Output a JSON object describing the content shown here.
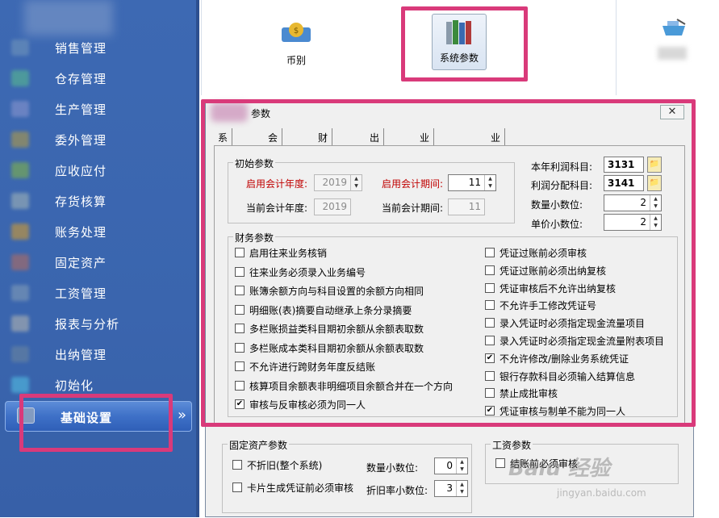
{
  "sidebar": {
    "items": [
      {
        "label": "销售管理",
        "icon": "sales-icon",
        "color": "#5f86b8"
      },
      {
        "label": "仓存管理",
        "icon": "warehouse-icon",
        "color": "#4f9f9a"
      },
      {
        "label": "生产管理",
        "icon": "production-icon",
        "color": "#6f86c4"
      },
      {
        "label": "委外管理",
        "icon": "outsourcing-icon",
        "color": "#8a8a6a"
      },
      {
        "label": "应收应付",
        "icon": "receivable-icon",
        "color": "#6a9a6a"
      },
      {
        "label": "存货核算",
        "icon": "inventory-icon",
        "color": "#7f9ab4"
      },
      {
        "label": "账务处理",
        "icon": "accounting-icon",
        "color": "#a08a5a"
      },
      {
        "label": "固定资产",
        "icon": "fixed-asset-icon",
        "color": "#8a6a7a"
      },
      {
        "label": "工资管理",
        "icon": "payroll-icon",
        "color": "#6a8ab4"
      },
      {
        "label": "报表与分析",
        "icon": "report-icon",
        "color": "#8a9ab0"
      },
      {
        "label": "出纳管理",
        "icon": "cashier-icon",
        "color": "#5a7aa4"
      },
      {
        "label": "初始化",
        "icon": "init-icon",
        "color": "#4aa0d0"
      }
    ],
    "active": {
      "label": "基础设置",
      "icon": "settings-icon"
    },
    "chevron": "»"
  },
  "toolbar": {
    "buttons": [
      {
        "label": "币别",
        "icon": "currency-icon"
      },
      {
        "label": "系统参数",
        "icon": "books-icon"
      },
      {
        "label": "",
        "icon": "shop-icon"
      }
    ]
  },
  "dialog": {
    "title": "参数",
    "close": "✕",
    "tabs": [
      "系统信息",
      "会计期间",
      "财务参数",
      "出纳参数",
      "业务基础参数",
      "业务参数"
    ],
    "active_tab": "财务参数",
    "init_group": {
      "title": "初始参数",
      "enable_year_label": "启用会计年度:",
      "enable_year": "2019",
      "enable_period_label": "启用会计期间:",
      "enable_period": "11",
      "current_year_label": "当前会计年度:",
      "current_year": "2019",
      "current_period_label": "当前会计期间:",
      "current_period": "11"
    },
    "right_fields": {
      "profit_account_label": "本年利润科目:",
      "profit_account": "3131",
      "distribution_account_label": "利润分配科目:",
      "distribution_account": "3141",
      "qty_decimals_label": "数量小数位:",
      "qty_decimals": "2",
      "price_decimals_label": "单价小数位:",
      "price_decimals": "2"
    },
    "finance_group": {
      "title": "财务参数",
      "left": [
        {
          "label": "启用往来业务核销",
          "checked": false
        },
        {
          "label": "往来业务必须录入业务编号",
          "checked": false
        },
        {
          "label": "账簿余额方向与科目设置的余额方向相同",
          "checked": false
        },
        {
          "label": "明细账(表)摘要自动继承上条分录摘要",
          "checked": false
        },
        {
          "label": "多栏账损益类科目期初余额从余额表取数",
          "checked": false
        },
        {
          "label": "多栏账成本类科目期初余额从余额表取数",
          "checked": false
        },
        {
          "label": "不允许进行跨财务年度反结账",
          "checked": false
        },
        {
          "label": "核算项目余额表非明细项目余额合并在一个方向",
          "checked": false
        },
        {
          "label": "审核与反审核必须为同一人",
          "checked": true
        }
      ],
      "right": [
        {
          "label": "凭证过账前必须审核",
          "checked": false
        },
        {
          "label": "凭证过账前必须出纳复核",
          "checked": false
        },
        {
          "label": "凭证审核后不允许出纳复核",
          "checked": false
        },
        {
          "label": "不允许手工修改凭证号",
          "checked": false
        },
        {
          "label": "录入凭证时必须指定现金流量项目",
          "checked": false
        },
        {
          "label": "录入凭证时必须指定现金流量附表项目",
          "checked": false
        },
        {
          "label": "不允许修改/删除业务系统凭证",
          "checked": true
        },
        {
          "label": "银行存款科目必须输入结算信息",
          "checked": false
        },
        {
          "label": "禁止成批审核",
          "checked": false
        },
        {
          "label": "凭证审核与制单不能为同一人",
          "checked": true
        }
      ]
    },
    "fixed_asset_group": {
      "title": "固定资产参数",
      "no_depreciation": "不折旧(整个系统)",
      "card_voucher": "卡片生成凭证前必须审核",
      "qty_decimals_label": "数量小数位:",
      "qty_decimals": "0",
      "dep_rate_decimals_label": "折旧率小数位:",
      "dep_rate_decimals": "3"
    },
    "payroll_group": {
      "title": "工资参数",
      "must_audit": "结账前必须审核"
    }
  },
  "watermark": {
    "big": "Baiu 经验",
    "small": "jingyan.baidu.com"
  },
  "highlight_color": "#d93a7a"
}
